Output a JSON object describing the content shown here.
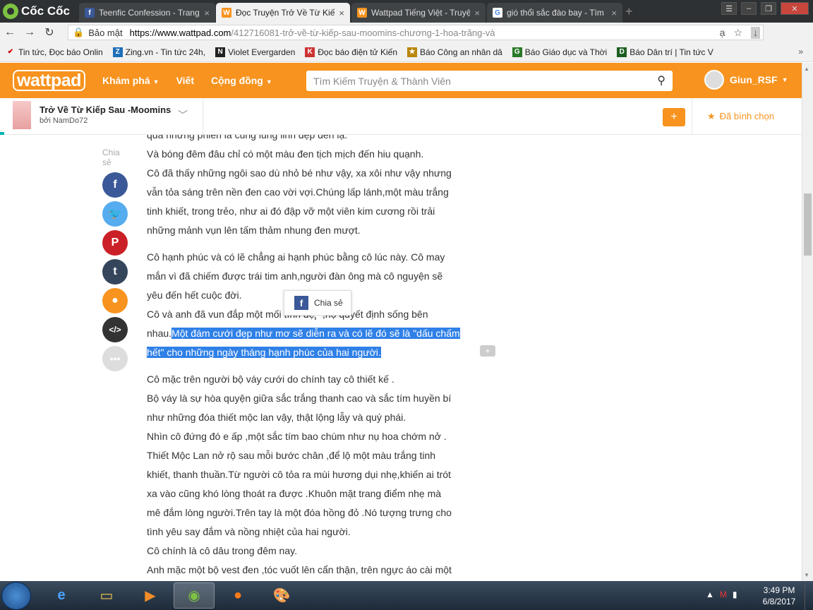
{
  "browser": {
    "name": "Cốc Cốc",
    "tabs": [
      {
        "label": "Teenfic Confession - Trang",
        "icon": "facebook-icon"
      },
      {
        "label": "Đọc Truyện Trở Về Từ Kiếp",
        "icon": "wattpad-icon",
        "active": true
      },
      {
        "label": "Wattpad Tiếng Việt - Truyệ",
        "icon": "wattpad-icon"
      },
      {
        "label": "gió thổi sắc đào bay - Tìm",
        "icon": "google-icon"
      }
    ],
    "address": {
      "secure_label": "Bảo mật",
      "url_domain": "https://www.wattpad.com",
      "url_path": "/412716081-trở-về-từ-kiếp-sau-moomins-chương-1-hoa-trăng-và"
    },
    "bookmarks": [
      "Tin tức, Đọc báo Onlin",
      "Zing.vn - Tin tức 24h,",
      "Violet Evergarden",
      "Đọc báo điện tử Kiến",
      "Báo Công an nhân dâ",
      "Báo Giáo dục và Thời",
      "Báo Dân trí | Tin tức V"
    ]
  },
  "wattpad": {
    "logo": "wattpad",
    "nav": [
      "Khám phá",
      "Viết",
      "Cộng đồng"
    ],
    "search_placeholder": "Tìm Kiếm Truyện & Thành Viên",
    "username": "Giun_RSF"
  },
  "story": {
    "title": "Trở Về Từ Kiếp Sau -Moomins",
    "author": "bởi NamDo72",
    "plus_label": "+",
    "vote_label": "Đã bình chọn"
  },
  "share": {
    "caption_1": "Chia",
    "caption_2": "sẻ",
    "popup_label": "Chia sẻ"
  },
  "text": {
    "p1": [
      "qua những phiến lá cũng lung linh đẹp đến lạ.",
      "Và bóng đêm đâu chỉ có một màu đen tịch mịch đến hiu quạnh.",
      "Cô đã thấy những ngôi sao dù nhỏ bé như vậy, xa xôi như vậy nhưng",
      "vẫn tỏa sáng trên nền đen cao vời vợi.Chúng lấp lánh,một màu trắng",
      "tinh khiết, trong trẻo, như ai đó đập vỡ một viên kim cương rồi trải",
      "những mảnh vụn lên tấm thảm nhung đen mượt."
    ],
    "p2": [
      "Cô hạnh phúc và có lẽ chẳng ai hạnh phúc bằng cô lúc này. Cô may",
      "mắn vì đã chiếm được trái tim anh,người đàn ông mà cô nguyện sẽ",
      "yêu đến hết cuộc đời.",
      "Cô và anh đã vun đắp một mối tình đẹp ,họ quyết định sống bên"
    ],
    "p2_last_plain": "nhau.",
    "p2_last_highlight": "Một đám cưới đẹp như mơ sẽ diễn ra và có lẽ đó sẽ là \"dấu chấm",
    "p2_highlight_2": "hết\" cho những ngày tháng hạnh phúc của hai người.",
    "p3": [
      "Cô mặc trên người bộ váy cưới do chính tay cô thiết kế .",
      "Bộ váy là sự hòa quyện giữa sắc  trắng thanh cao và sắc tím huyền bí",
      "như những đóa thiết mộc lan vậy, thật lộng lẫy và quý phái.",
      "Nhìn cô đứng đó e ấp ,một sắc tím bao chùm như nụ hoa chớm nở .",
      "Thiết Mộc Lan nở rộ sau mỗi bước chân ,để lộ một màu trắng tinh",
      "khiết, thanh thuần.Từ người cô tỏa ra mùi hương dụi nhẹ,khiến ai trót",
      "xa vào cũng khó lòng thoát ra được .Khuôn mặt trang điểm nhẹ mà",
      "mê đắm lòng người.Trên tay là một đóa hồng đỏ .Nó tượng trưng cho",
      "tình yêu say đắm và nồng nhiệt của hai người.",
      "Cô chính là cô dâu trong đêm nay.",
      "Anh mặc một bộ vest đen ,tóc vuốt lên cẩn thận, trên ngực áo cài một"
    ]
  },
  "taskbar": {
    "time": "3:49 PM",
    "date": "6/8/2017"
  },
  "colors": {
    "wattpad_orange": "#f7931e",
    "selection_blue": "#2f80e7",
    "facebook": "#3b5998",
    "twitter": "#55acee",
    "pinterest": "#cb2027",
    "tumblr": "#35465c"
  }
}
